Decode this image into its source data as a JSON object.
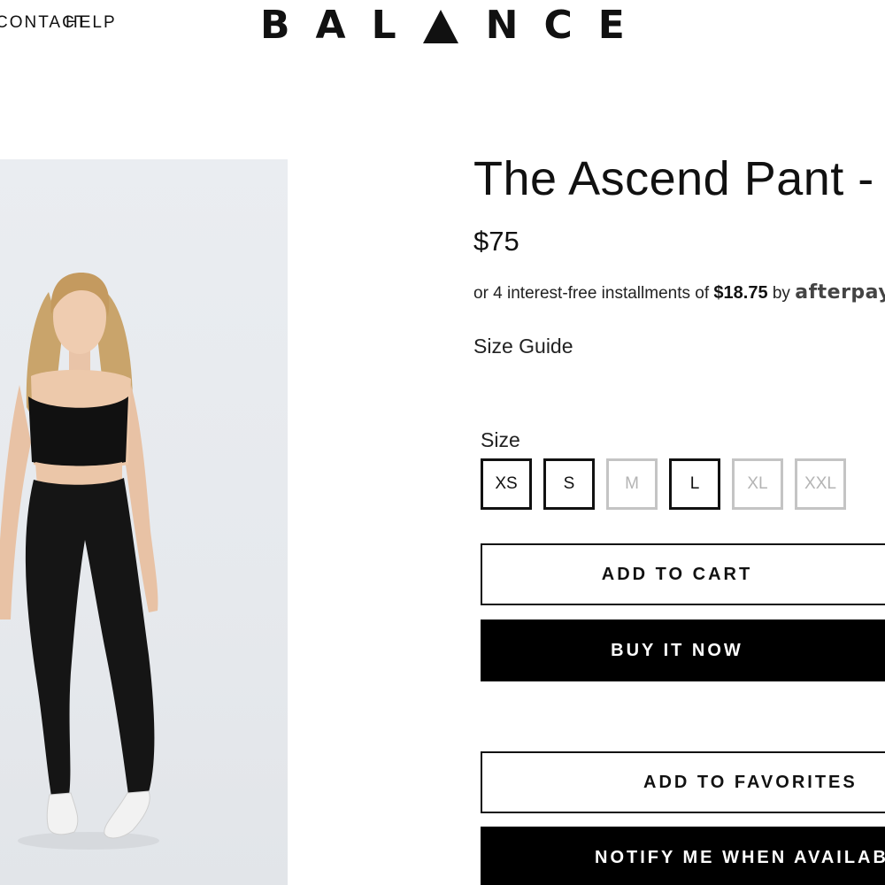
{
  "header": {
    "nav_contact": "CONTACT",
    "nav_help": "HELP",
    "logo_left": "BAL",
    "logo_right": "NCE",
    "logo_triangle_icon": "triangle-logo-icon"
  },
  "product": {
    "title": "The Ascend Pant - Black",
    "price": "$75",
    "installments": {
      "prefix": "or 4 interest-free installments of",
      "amount": "$18.75",
      "by": "by",
      "provider": "afterpay"
    },
    "size_guide": "Size Guide",
    "size_label": "Size",
    "sizes": [
      {
        "label": "XS",
        "available": true
      },
      {
        "label": "S",
        "available": true
      },
      {
        "label": "M",
        "available": false
      },
      {
        "label": "L",
        "available": true
      },
      {
        "label": "XL",
        "available": false
      },
      {
        "label": "XXL",
        "available": false
      }
    ]
  },
  "actions": {
    "add_to_cart": "ADD TO CART",
    "buy_now": "BUY IT NOW",
    "add_to_favorites": "ADD TO FAVORITES",
    "notify_me": "NOTIFY ME WHEN AVAILABLE"
  },
  "colors": {
    "text": "#111111",
    "image_bg": "#e8ebef",
    "unavailable_border": "#c4c4c4",
    "button_solid": "#000000"
  }
}
